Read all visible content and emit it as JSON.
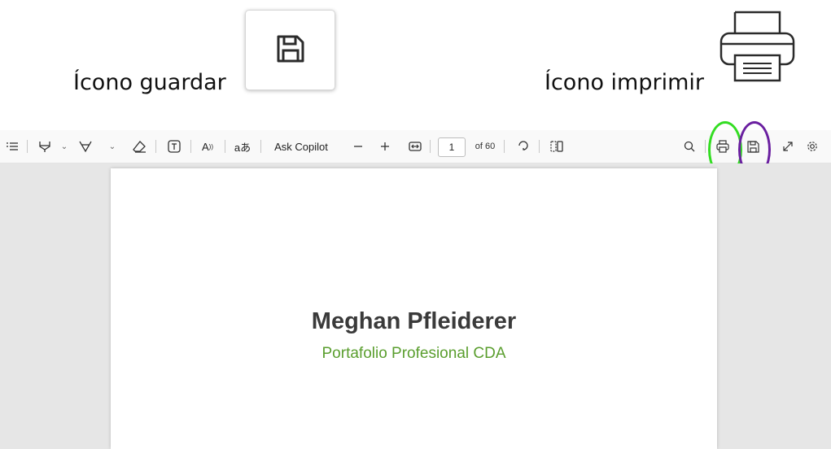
{
  "labels": {
    "save": "Ícono guardar",
    "print": "Ícono imprimir"
  },
  "toolbar": {
    "ask_copilot": "Ask Copilot",
    "page_current": "1",
    "page_total": "of 60",
    "translate_glyph": "aあ",
    "read_aloud_glyph": "A",
    "icons": [
      "contents-icon",
      "highlight-icon",
      "draw-icon",
      "eraser-icon",
      "text-box-icon",
      "read-aloud-icon",
      "translate-icon",
      "zoom-out-icon",
      "zoom-in-icon",
      "fit-width-icon",
      "rotate-icon",
      "page-view-icon",
      "search-icon",
      "print-icon",
      "save-icon",
      "fullscreen-icon",
      "settings-icon"
    ]
  },
  "annotations": {
    "print_ring_color": "#33dd22",
    "save_ring_color": "#6a1fa0"
  },
  "document": {
    "title": "Meghan Pfleiderer",
    "subtitle": "Portafolio Profesional CDA"
  }
}
